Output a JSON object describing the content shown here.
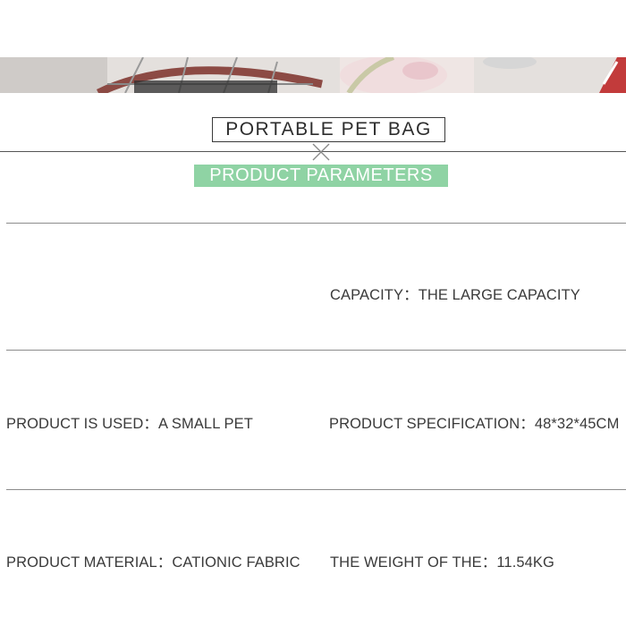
{
  "banner": {
    "image_description": "photo-strip"
  },
  "header": {
    "title": "PORTABLE PET BAG",
    "subtitle": "PRODUCT PARAMETERS",
    "subtitle_bg": "#8fd3a4"
  },
  "params": {
    "capacity": "CAPACITY：THE LARGE CAPACITY",
    "used": "PRODUCT IS USED：A SMALL PET",
    "spec": "PRODUCT SPECIFICATION：48*32*45CM",
    "material": "PRODUCT MATERIAL：CATIONIC FABRIC",
    "weight": "THE WEIGHT OF THE：11.54KG"
  }
}
